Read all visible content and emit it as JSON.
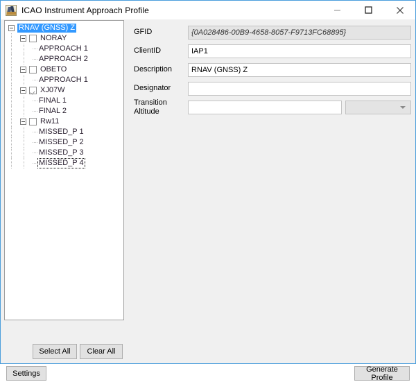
{
  "window": {
    "title": "ICAO Instrument Approach Profile",
    "icon": "app-icon",
    "controls": {
      "minimize": "minimize-icon",
      "maximize": "maximize-icon",
      "close": "close-icon"
    },
    "border_color": "#4a9edc",
    "background": "#f0f0f0"
  },
  "tree": {
    "selection_color": "#3399ff",
    "nodes": [
      {
        "label": "RNAV (GNSS) Z",
        "level": 0,
        "expander": true,
        "checkbox": false,
        "checked": false,
        "selected": true,
        "focused": false
      },
      {
        "label": "NORAY",
        "level": 1,
        "expander": true,
        "checkbox": true,
        "checked": false,
        "selected": false,
        "focused": false
      },
      {
        "label": "APPROACH 1",
        "level": 2,
        "expander": false,
        "checkbox": false,
        "checked": false,
        "selected": false,
        "focused": false
      },
      {
        "label": "APPROACH 2",
        "level": 2,
        "expander": false,
        "checkbox": false,
        "checked": false,
        "selected": false,
        "focused": false
      },
      {
        "label": "OBETO",
        "level": 1,
        "expander": true,
        "checkbox": true,
        "checked": false,
        "selected": false,
        "focused": false
      },
      {
        "label": "APPROACH 1",
        "level": 2,
        "expander": false,
        "checkbox": false,
        "checked": false,
        "selected": false,
        "focused": false
      },
      {
        "label": "XJ07W",
        "level": 1,
        "expander": true,
        "checkbox": true,
        "checked": true,
        "selected": false,
        "focused": false
      },
      {
        "label": "FINAL 1",
        "level": 2,
        "expander": false,
        "checkbox": false,
        "checked": false,
        "selected": false,
        "focused": false
      },
      {
        "label": "FINAL 2",
        "level": 2,
        "expander": false,
        "checkbox": false,
        "checked": false,
        "selected": false,
        "focused": false
      },
      {
        "label": "Rw11",
        "level": 1,
        "expander": true,
        "checkbox": true,
        "checked": false,
        "selected": false,
        "focused": false
      },
      {
        "label": "MISSED_P 1",
        "level": 2,
        "expander": false,
        "checkbox": false,
        "checked": false,
        "selected": false,
        "focused": false
      },
      {
        "label": "MISSED_P 2",
        "level": 2,
        "expander": false,
        "checkbox": false,
        "checked": false,
        "selected": false,
        "focused": false
      },
      {
        "label": "MISSED_P 3",
        "level": 2,
        "expander": false,
        "checkbox": false,
        "checked": false,
        "selected": false,
        "focused": false
      },
      {
        "label": "MISSED_P 4",
        "level": 2,
        "expander": false,
        "checkbox": false,
        "checked": false,
        "selected": false,
        "focused": true
      }
    ]
  },
  "tree_buttons": {
    "select_all": "Select All",
    "clear_all": "Clear All"
  },
  "form": {
    "gfid": {
      "label": "GFID",
      "value": "{0A028486-00B9-4658-8057-F9713FC68895}",
      "readonly": true
    },
    "client_id": {
      "label": "ClientID",
      "value": "IAP1",
      "placeholder": ""
    },
    "description": {
      "label": "Description",
      "value": "RNAV (GNSS) Z",
      "placeholder": ""
    },
    "designator": {
      "label": "Designator",
      "value": "",
      "placeholder": ""
    },
    "transition_altitude": {
      "label": "Transition Altitude",
      "value": "",
      "placeholder": "",
      "unit_value": "",
      "unit_icon": "chevron-down-icon"
    }
  },
  "footer": {
    "settings": "Settings",
    "generate_profile": "Generate Profile"
  }
}
